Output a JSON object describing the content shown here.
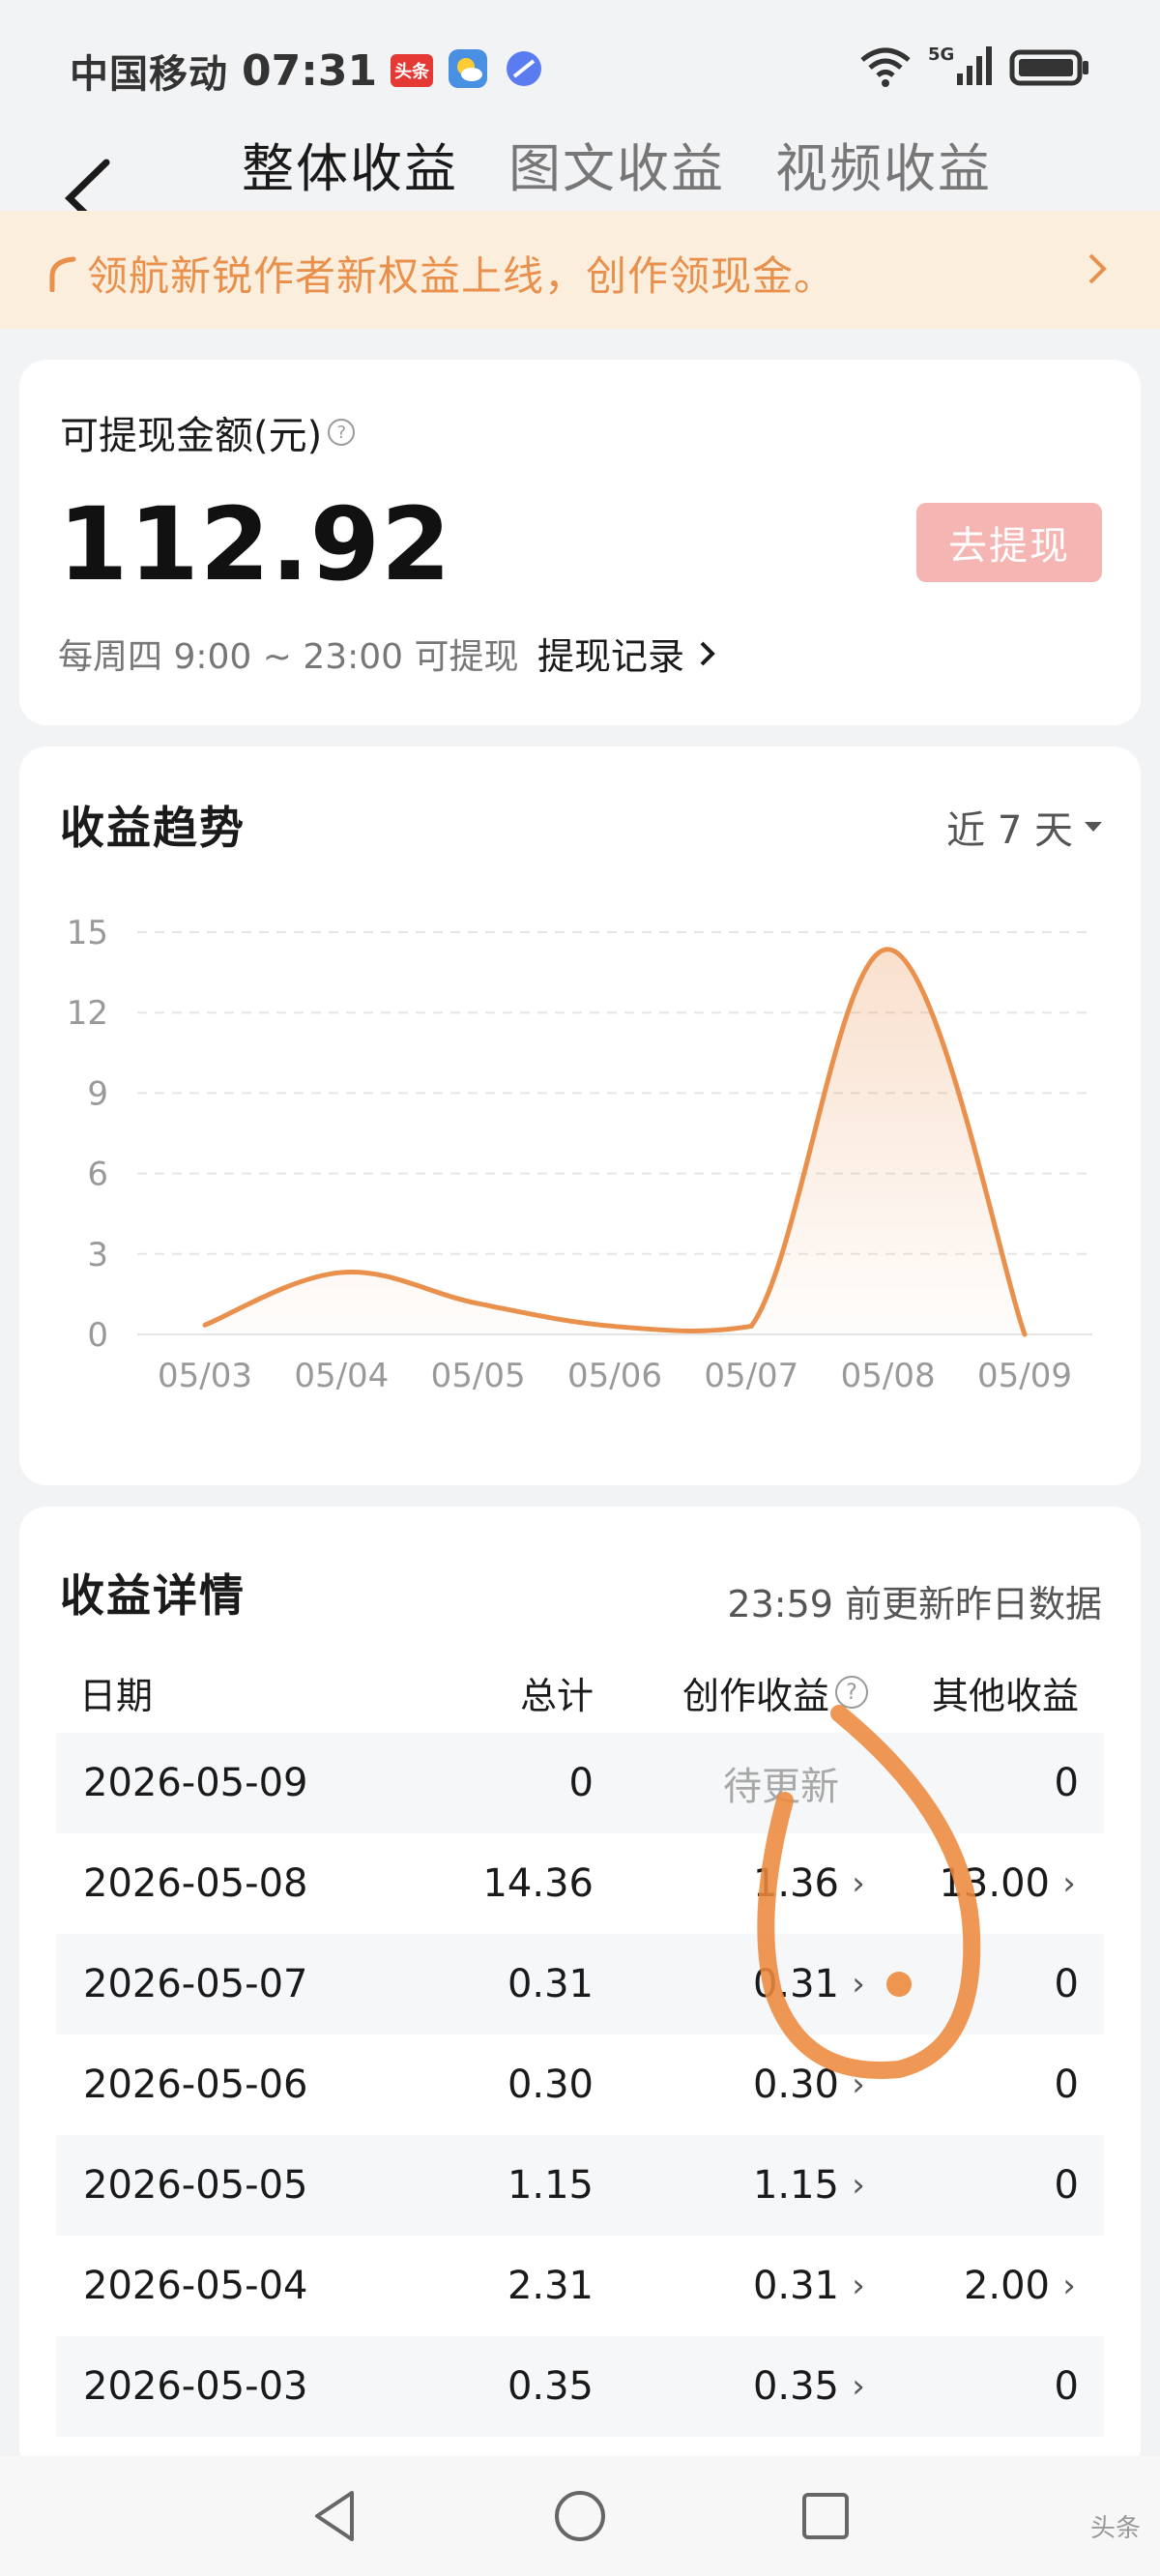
{
  "status_bar": {
    "carrier": "中国移动",
    "time": "07:31",
    "badge": "头条",
    "signal": "5G"
  },
  "header": {
    "tabs": [
      {
        "label": "整体收益",
        "active": true
      },
      {
        "label": "图文收益",
        "active": false
      },
      {
        "label": "视频收益",
        "active": false
      }
    ]
  },
  "banner": {
    "text": "领航新锐作者新权益上线，创作领现金。",
    "color": "#e9904d"
  },
  "withdraw": {
    "label": "可提现金额(元)",
    "amount": "112.92",
    "button": "去提现",
    "hint": "每周四 9:00 ~ 23:00 可提现",
    "record": "提现记录"
  },
  "trend": {
    "title": "收益趋势",
    "range": "近 7 天",
    "chart_data": {
      "type": "area",
      "title": "收益趋势",
      "categories": [
        "05/03",
        "05/04",
        "05/05",
        "05/06",
        "05/07",
        "05/08",
        "05/09"
      ],
      "series": [
        {
          "values": [
            0.35,
            2.31,
            1.15,
            0.3,
            0.31,
            14.36,
            0
          ]
        }
      ],
      "y_ticks": [
        "15",
        "12",
        "9",
        "6",
        "3",
        "0"
      ],
      "ylim": [
        0,
        15
      ],
      "grid": true,
      "color": "#e9904d"
    }
  },
  "detail": {
    "title": "收益详情",
    "note": "23:59 前更新昨日数据",
    "columns": {
      "date": "日期",
      "total": "总计",
      "create": "创作收益",
      "other": "其他收益"
    },
    "rows": [
      {
        "date": "2026-05-09",
        "total": "0",
        "create": "待更新",
        "other": "0"
      },
      {
        "date": "2026-05-08",
        "total": "14.36",
        "create": "1.36",
        "other": "13.00"
      },
      {
        "date": "2026-05-07",
        "total": "0.31",
        "create": "0.31",
        "other": "0"
      },
      {
        "date": "2026-05-06",
        "total": "0.30",
        "create": "0.30",
        "other": "0"
      },
      {
        "date": "2026-05-05",
        "total": "1.15",
        "create": "1.15",
        "other": "0"
      },
      {
        "date": "2026-05-04",
        "total": "2.31",
        "create": "0.31",
        "other": "2.00"
      },
      {
        "date": "2026-05-03",
        "total": "0.35",
        "create": "0.35",
        "other": "0"
      }
    ]
  },
  "navbar": {
    "watermark": "头条"
  }
}
